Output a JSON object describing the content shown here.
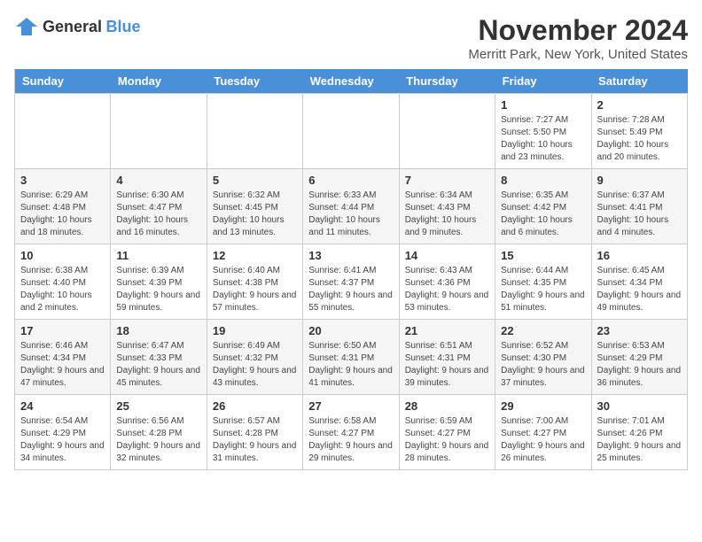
{
  "logo": {
    "text_general": "General",
    "text_blue": "Blue"
  },
  "title": "November 2024",
  "location": "Merritt Park, New York, United States",
  "days_of_week": [
    "Sunday",
    "Monday",
    "Tuesday",
    "Wednesday",
    "Thursday",
    "Friday",
    "Saturday"
  ],
  "weeks": [
    [
      {
        "day": "",
        "info": ""
      },
      {
        "day": "",
        "info": ""
      },
      {
        "day": "",
        "info": ""
      },
      {
        "day": "",
        "info": ""
      },
      {
        "day": "",
        "info": ""
      },
      {
        "day": "1",
        "info": "Sunrise: 7:27 AM\nSunset: 5:50 PM\nDaylight: 10 hours and 23 minutes."
      },
      {
        "day": "2",
        "info": "Sunrise: 7:28 AM\nSunset: 5:49 PM\nDaylight: 10 hours and 20 minutes."
      }
    ],
    [
      {
        "day": "3",
        "info": "Sunrise: 6:29 AM\nSunset: 4:48 PM\nDaylight: 10 hours and 18 minutes."
      },
      {
        "day": "4",
        "info": "Sunrise: 6:30 AM\nSunset: 4:47 PM\nDaylight: 10 hours and 16 minutes."
      },
      {
        "day": "5",
        "info": "Sunrise: 6:32 AM\nSunset: 4:45 PM\nDaylight: 10 hours and 13 minutes."
      },
      {
        "day": "6",
        "info": "Sunrise: 6:33 AM\nSunset: 4:44 PM\nDaylight: 10 hours and 11 minutes."
      },
      {
        "day": "7",
        "info": "Sunrise: 6:34 AM\nSunset: 4:43 PM\nDaylight: 10 hours and 9 minutes."
      },
      {
        "day": "8",
        "info": "Sunrise: 6:35 AM\nSunset: 4:42 PM\nDaylight: 10 hours and 6 minutes."
      },
      {
        "day": "9",
        "info": "Sunrise: 6:37 AM\nSunset: 4:41 PM\nDaylight: 10 hours and 4 minutes."
      }
    ],
    [
      {
        "day": "10",
        "info": "Sunrise: 6:38 AM\nSunset: 4:40 PM\nDaylight: 10 hours and 2 minutes."
      },
      {
        "day": "11",
        "info": "Sunrise: 6:39 AM\nSunset: 4:39 PM\nDaylight: 9 hours and 59 minutes."
      },
      {
        "day": "12",
        "info": "Sunrise: 6:40 AM\nSunset: 4:38 PM\nDaylight: 9 hours and 57 minutes."
      },
      {
        "day": "13",
        "info": "Sunrise: 6:41 AM\nSunset: 4:37 PM\nDaylight: 9 hours and 55 minutes."
      },
      {
        "day": "14",
        "info": "Sunrise: 6:43 AM\nSunset: 4:36 PM\nDaylight: 9 hours and 53 minutes."
      },
      {
        "day": "15",
        "info": "Sunrise: 6:44 AM\nSunset: 4:35 PM\nDaylight: 9 hours and 51 minutes."
      },
      {
        "day": "16",
        "info": "Sunrise: 6:45 AM\nSunset: 4:34 PM\nDaylight: 9 hours and 49 minutes."
      }
    ],
    [
      {
        "day": "17",
        "info": "Sunrise: 6:46 AM\nSunset: 4:34 PM\nDaylight: 9 hours and 47 minutes."
      },
      {
        "day": "18",
        "info": "Sunrise: 6:47 AM\nSunset: 4:33 PM\nDaylight: 9 hours and 45 minutes."
      },
      {
        "day": "19",
        "info": "Sunrise: 6:49 AM\nSunset: 4:32 PM\nDaylight: 9 hours and 43 minutes."
      },
      {
        "day": "20",
        "info": "Sunrise: 6:50 AM\nSunset: 4:31 PM\nDaylight: 9 hours and 41 minutes."
      },
      {
        "day": "21",
        "info": "Sunrise: 6:51 AM\nSunset: 4:31 PM\nDaylight: 9 hours and 39 minutes."
      },
      {
        "day": "22",
        "info": "Sunrise: 6:52 AM\nSunset: 4:30 PM\nDaylight: 9 hours and 37 minutes."
      },
      {
        "day": "23",
        "info": "Sunrise: 6:53 AM\nSunset: 4:29 PM\nDaylight: 9 hours and 36 minutes."
      }
    ],
    [
      {
        "day": "24",
        "info": "Sunrise: 6:54 AM\nSunset: 4:29 PM\nDaylight: 9 hours and 34 minutes."
      },
      {
        "day": "25",
        "info": "Sunrise: 6:56 AM\nSunset: 4:28 PM\nDaylight: 9 hours and 32 minutes."
      },
      {
        "day": "26",
        "info": "Sunrise: 6:57 AM\nSunset: 4:28 PM\nDaylight: 9 hours and 31 minutes."
      },
      {
        "day": "27",
        "info": "Sunrise: 6:58 AM\nSunset: 4:27 PM\nDaylight: 9 hours and 29 minutes."
      },
      {
        "day": "28",
        "info": "Sunrise: 6:59 AM\nSunset: 4:27 PM\nDaylight: 9 hours and 28 minutes."
      },
      {
        "day": "29",
        "info": "Sunrise: 7:00 AM\nSunset: 4:27 PM\nDaylight: 9 hours and 26 minutes."
      },
      {
        "day": "30",
        "info": "Sunrise: 7:01 AM\nSunset: 4:26 PM\nDaylight: 9 hours and 25 minutes."
      }
    ]
  ]
}
